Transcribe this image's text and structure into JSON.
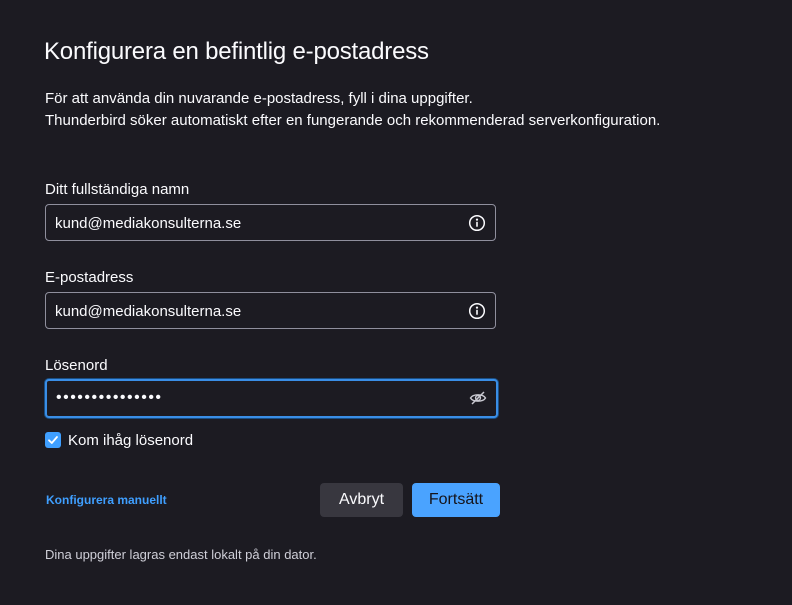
{
  "page": {
    "title": "Konfigurera en befintlig e-postadress",
    "intro_line1": "För att använda din nuvarande e-postadress, fyll i dina uppgifter.",
    "intro_line2": "Thunderbird söker automatiskt efter en fungerande och rekommenderad serverkonfiguration."
  },
  "form": {
    "name": {
      "label": "Ditt fullständiga namn",
      "value": "kund@mediakonsulterna.se",
      "icon": "info-icon"
    },
    "email": {
      "label": "E-postadress",
      "value": "kund@mediakonsulterna.se",
      "icon": "info-icon"
    },
    "password": {
      "label": "Lösenord",
      "value": "•••••••••••••••",
      "icon": "eye-slash-icon"
    },
    "remember": {
      "label": "Kom ihåg lösenord",
      "checked": true
    }
  },
  "actions": {
    "manual_config": "Konfigurera manuellt",
    "cancel": "Avbryt",
    "continue": "Fortsätt"
  },
  "footer": {
    "note": "Dina uppgifter lagras endast lokalt på din dator."
  },
  "colors": {
    "background": "#1c1b22",
    "accent": "#3f9fff",
    "focus_border": "#3a8ee6",
    "input_border": "#8f8f9d"
  }
}
